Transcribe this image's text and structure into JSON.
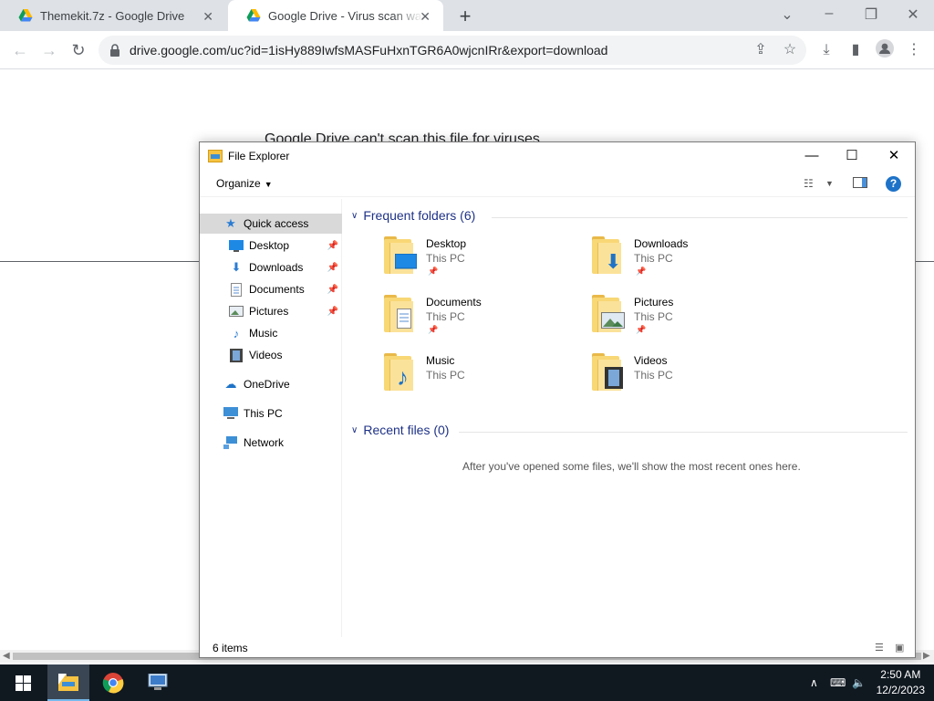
{
  "browser": {
    "tabs": [
      {
        "title": "Themekit.7z - Google Drive",
        "active": false
      },
      {
        "title": "Google Drive - Virus scan warning",
        "active": true
      }
    ],
    "new_tab_symbol": "+",
    "url": "drive.google.com/uc?id=1isHy889IwfsMASFuHxnTGR6A0wjcnIRr&export=download"
  },
  "page": {
    "heading": "Google Drive can't scan this file for viruses"
  },
  "explorer": {
    "title": "File Explorer",
    "organize_label": "Organize",
    "help_label": "?",
    "nav": {
      "quick_access": "Quick access",
      "items": [
        {
          "label": "Desktop",
          "pinned": true,
          "icon": "desktop-icon"
        },
        {
          "label": "Downloads",
          "pinned": true,
          "icon": "downloads-icon"
        },
        {
          "label": "Documents",
          "pinned": true,
          "icon": "documents-icon"
        },
        {
          "label": "Pictures",
          "pinned": true,
          "icon": "pictures-icon"
        },
        {
          "label": "Music",
          "pinned": false,
          "icon": "music-icon"
        },
        {
          "label": "Videos",
          "pinned": false,
          "icon": "videos-icon"
        }
      ],
      "onedrive": "OneDrive",
      "this_pc": "This PC",
      "network": "Network"
    },
    "frequent_header": "Frequent folders (6)",
    "folders": [
      {
        "name": "Desktop",
        "location": "This PC",
        "pinned": true
      },
      {
        "name": "Downloads",
        "location": "This PC",
        "pinned": true
      },
      {
        "name": "Documents",
        "location": "This PC",
        "pinned": true
      },
      {
        "name": "Pictures",
        "location": "This PC",
        "pinned": true
      },
      {
        "name": "Music",
        "location": "This PC",
        "pinned": false
      },
      {
        "name": "Videos",
        "location": "This PC",
        "pinned": false
      }
    ],
    "recent_header": "Recent files (0)",
    "recent_empty_message": "After you've opened some files, we'll show the most recent ones here.",
    "status_count": "6 items"
  },
  "taskbar": {
    "time": "2:50 AM",
    "date": "12/2/2023"
  },
  "colors": {
    "accent": "#1e73c8",
    "header_text": "#1e3287",
    "taskbar": "#101820"
  }
}
